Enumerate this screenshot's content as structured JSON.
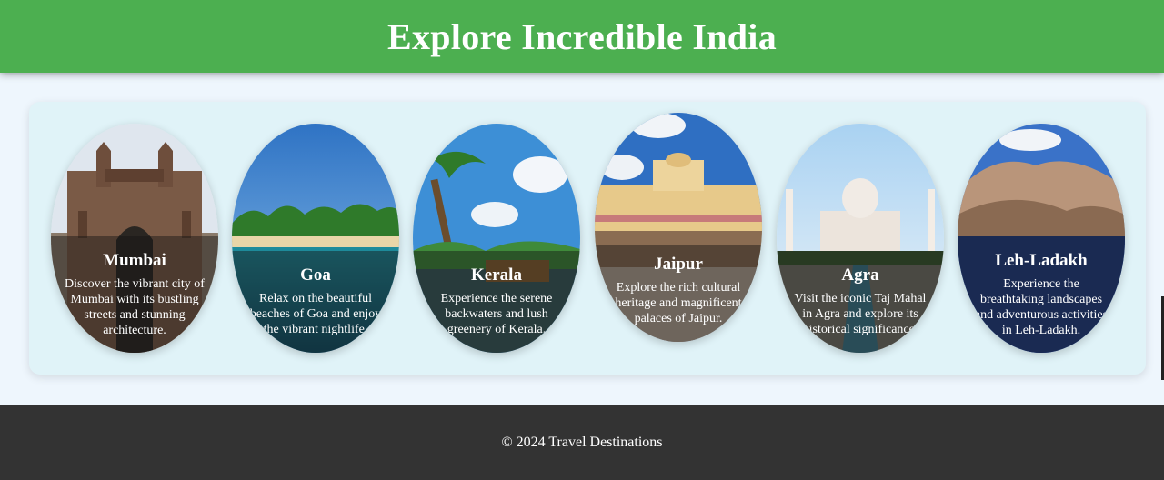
{
  "header": {
    "title": "Explore Incredible India"
  },
  "destinations": [
    {
      "name": "Mumbai",
      "description": "Discover the vibrant city of Mumbai with its bustling streets and stunning architecture."
    },
    {
      "name": "Goa",
      "description": "Relax on the beautiful beaches of Goa and enjoy the vibrant nightlife."
    },
    {
      "name": "Kerala",
      "description": "Experience the serene backwaters and lush greenery of Kerala."
    },
    {
      "name": "Jaipur",
      "description": "Explore the rich cultural heritage and magnificent palaces of Jaipur."
    },
    {
      "name": "Agra",
      "description": "Visit the iconic Taj Mahal in Agra and explore its historical significance."
    },
    {
      "name": "Leh-Ladakh",
      "description": "Experience the breathtaking landscapes and adventurous activities in Leh-Ladakh."
    }
  ],
  "footer": {
    "text": "© 2024 Travel Destinations"
  },
  "colors": {
    "header": "#4caf50",
    "footer": "#333333",
    "panel": "#e0f3f8",
    "page": "#eef6fd"
  }
}
